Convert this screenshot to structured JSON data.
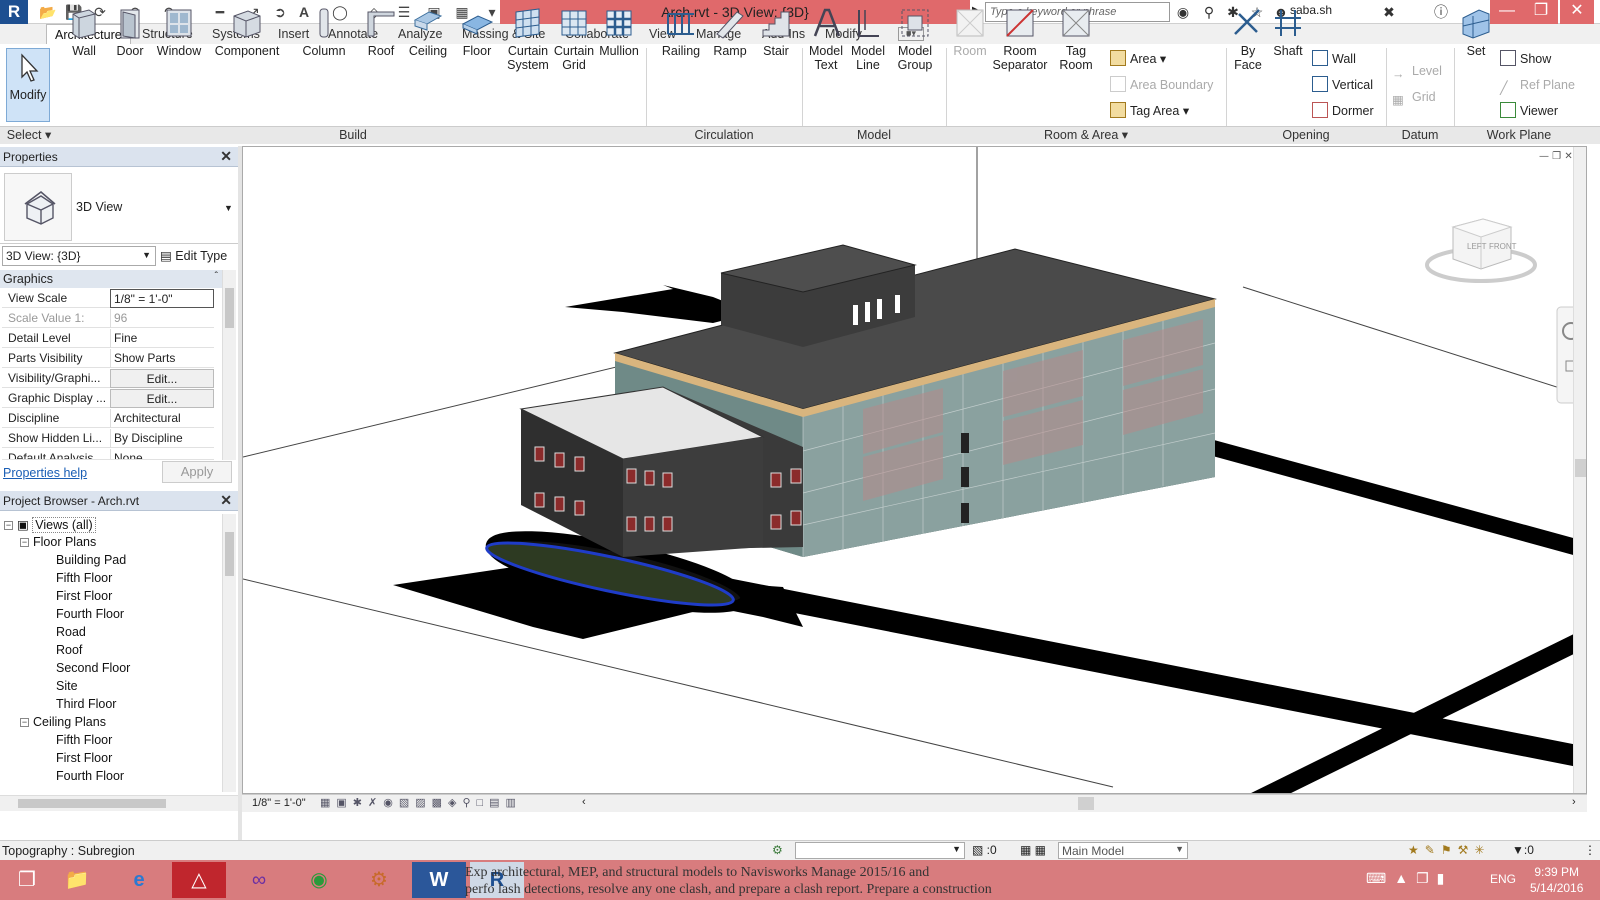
{
  "titlebar": {
    "app_logo": "R",
    "title": "Arch.rvt - 3D View: {3D}",
    "search_placeholder": "Type a keyword or phrase",
    "user": "saba.sh"
  },
  "tabs": [
    "Architecture",
    "Structure",
    "Systems",
    "Insert",
    "Annotate",
    "Analyze",
    "Massing & Site",
    "Collaborate",
    "View",
    "Manage",
    "Add-Ins",
    "Modify"
  ],
  "ribbon": {
    "modify": "Modify",
    "build": {
      "wall": "Wall",
      "door": "Door",
      "window": "Window",
      "component": "Component",
      "column": "Column",
      "roof": "Roof",
      "ceiling": "Ceiling",
      "floor": "Floor",
      "curtain_system_1": "Curtain",
      "curtain_system_2": "System",
      "curtain_grid_1": "Curtain",
      "curtain_grid_2": "Grid",
      "mullion": "Mullion"
    },
    "circulation": {
      "railing": "Railing",
      "ramp": "Ramp",
      "stair": "Stair"
    },
    "model": {
      "model_text_1": "Model",
      "model_text_2": "Text",
      "model_line_1": "Model",
      "model_line_2": "Line",
      "model_group_1": "Model",
      "model_group_2": "Group"
    },
    "room_area": {
      "room": "Room",
      "room_sep_1": "Room",
      "room_sep_2": "Separator",
      "tag_room_1": "Tag",
      "tag_room_2": "Room",
      "area": "Area",
      "area_boundary": "Area  Boundary",
      "tag_area": "Tag  Area"
    },
    "opening": {
      "by_face_1": "By",
      "by_face_2": "Face",
      "shaft": "Shaft",
      "wall": "Wall",
      "vertical": "Vertical",
      "dormer": "Dormer"
    },
    "datum": {
      "level": "Level",
      "grid": "Grid"
    },
    "work_plane": {
      "set": "Set",
      "show": "Show",
      "ref_plane": "Ref  Plane",
      "viewer": "Viewer"
    },
    "group_labels": {
      "select": "Select",
      "build": "Build",
      "circulation": "Circulation",
      "model": "Model",
      "room_area": "Room & Area",
      "opening": "Opening",
      "datum": "Datum",
      "work_plane": "Work Plane"
    }
  },
  "properties": {
    "title": "Properties",
    "type_name": "3D View",
    "view_select": "3D View: {3D}",
    "edit_type": "Edit Type",
    "section": "Graphics",
    "rows": [
      {
        "k": "View Scale",
        "v": "1/8\" = 1'-0\""
      },
      {
        "k": "Scale Value    1:",
        "v": "96"
      },
      {
        "k": "Detail Level",
        "v": "Fine"
      },
      {
        "k": "Parts Visibility",
        "v": "Show Parts"
      },
      {
        "k": "Visibility/Graphi...",
        "v": "Edit..."
      },
      {
        "k": "Graphic Display ...",
        "v": "Edit..."
      },
      {
        "k": "Discipline",
        "v": "Architectural"
      },
      {
        "k": "Show Hidden Li...",
        "v": "By Discipline"
      },
      {
        "k": "Default Analysis...",
        "v": "None"
      }
    ],
    "help": "Properties help",
    "apply": "Apply"
  },
  "browser": {
    "title": "Project Browser - Arch.rvt",
    "root": "Views (all)",
    "floor_plans": "Floor Plans",
    "floor_items": [
      "Building Pad",
      "Fifth Floor",
      "First Floor",
      "Fourth Floor",
      "Road",
      "Roof",
      "Second Floor",
      "Site",
      "Third Floor"
    ],
    "ceiling_plans": "Ceiling Plans",
    "ceiling_items": [
      "Fifth Floor",
      "First Floor",
      "Fourth Floor"
    ]
  },
  "viewcube": {
    "left": "LEFT",
    "front": "FRONT"
  },
  "view_controls": {
    "scale": "1/8\" = 1'-0\""
  },
  "status": {
    "text": "Topography : Subregion",
    "worksets": ":0",
    "main_model": "Main Model",
    "filter": ":0"
  },
  "taskbar": {
    "notice_line1": "Exp          architectural, MEP, and structural models to Navisworks Manage 2015/16 and",
    "notice_line2": "perfo   lash detections, resolve any one clash, and prepare a clash report. Prepare a construction",
    "lang": "ENG",
    "time": "9:39 PM",
    "date": "5/14/2016"
  },
  "colors": {
    "title_red": "#e0696b",
    "taskbar": "#d87c7e",
    "accent": "#1d4f91"
  }
}
